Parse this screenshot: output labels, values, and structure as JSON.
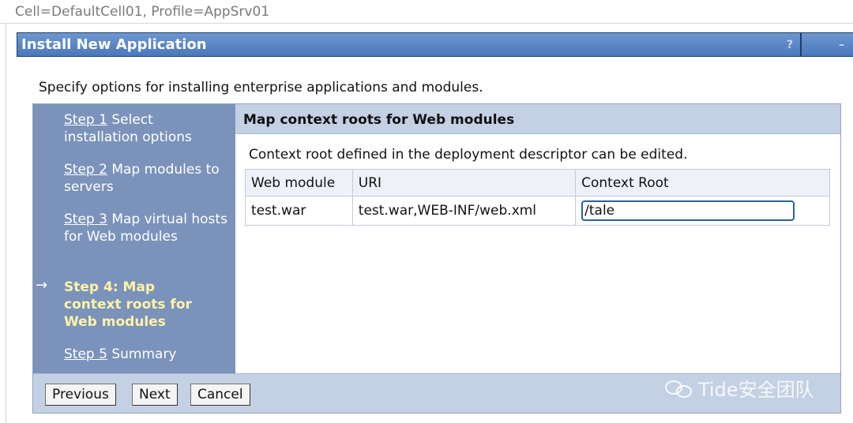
{
  "scope": "Cell=DefaultCell01, Profile=AppSrv01",
  "portlet": {
    "title": "Install New Application",
    "help": "?",
    "minimize": "–"
  },
  "intro": "Specify options for installing enterprise applications and modules.",
  "steps": [
    {
      "link": "Step 1",
      "text": "Select installation options"
    },
    {
      "link": "Step 2",
      "text": "Map modules to servers"
    },
    {
      "link": "Step 3",
      "text": "Map virtual hosts for Web modules"
    },
    {
      "current": "Step 4: Map context roots for Web modules",
      "arrow": "→"
    },
    {
      "link": "Step 5",
      "text": "Summary"
    }
  ],
  "content": {
    "heading": "Map context roots for Web modules",
    "description": "Context root defined in the deployment descriptor can be edited.",
    "columns": [
      "Web module",
      "URI",
      "Context Root"
    ],
    "rows": [
      {
        "module": "test.war",
        "uri": "test.war,WEB-INF/web.xml",
        "context_root": "/tale"
      }
    ]
  },
  "buttons": {
    "previous": "Previous",
    "next": "Next",
    "cancel": "Cancel"
  },
  "watermark": "Tide安全团队"
}
